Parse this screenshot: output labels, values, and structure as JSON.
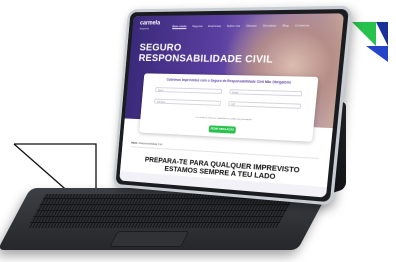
{
  "site": {
    "logo_name": "carmela",
    "logo_sub": "seguros"
  },
  "nav": {
    "items": [
      "Bem-vindo",
      "Seguros",
      "Empresas",
      "Sobre nós",
      "Clientes",
      "Simulador",
      "Blog",
      "Contactos"
    ]
  },
  "hero": {
    "title_line1": "SEGURO",
    "title_line2": "RESPONSABILIDADE CIVIL"
  },
  "form": {
    "title": "Cobrimos Imprevistos com o Seguro de Responsabilidade Civil Não Obrigatório",
    "field_name": "Nome",
    "field_email": "Email",
    "field_phone": "Telefone",
    "field_nif": "NIF",
    "consent": "Li e aceito os termos e condições e a política de privacidade",
    "submit_label": "PEDIR SIMULAÇÃO"
  },
  "breadcrumb": {
    "home": "Início",
    "current": "Responsabilidade Civil"
  },
  "tagline": {
    "line1": "PREPARA-TE PARA QUALQUER IMPREVISTO",
    "line2": "ESTAMOS SEMPRE A TEU LADO"
  },
  "colors": {
    "brand_purple": "#5b3fa0",
    "accent_green": "#27c24c",
    "corner_green": "#27c24c",
    "corner_blue": "#2545c9"
  }
}
